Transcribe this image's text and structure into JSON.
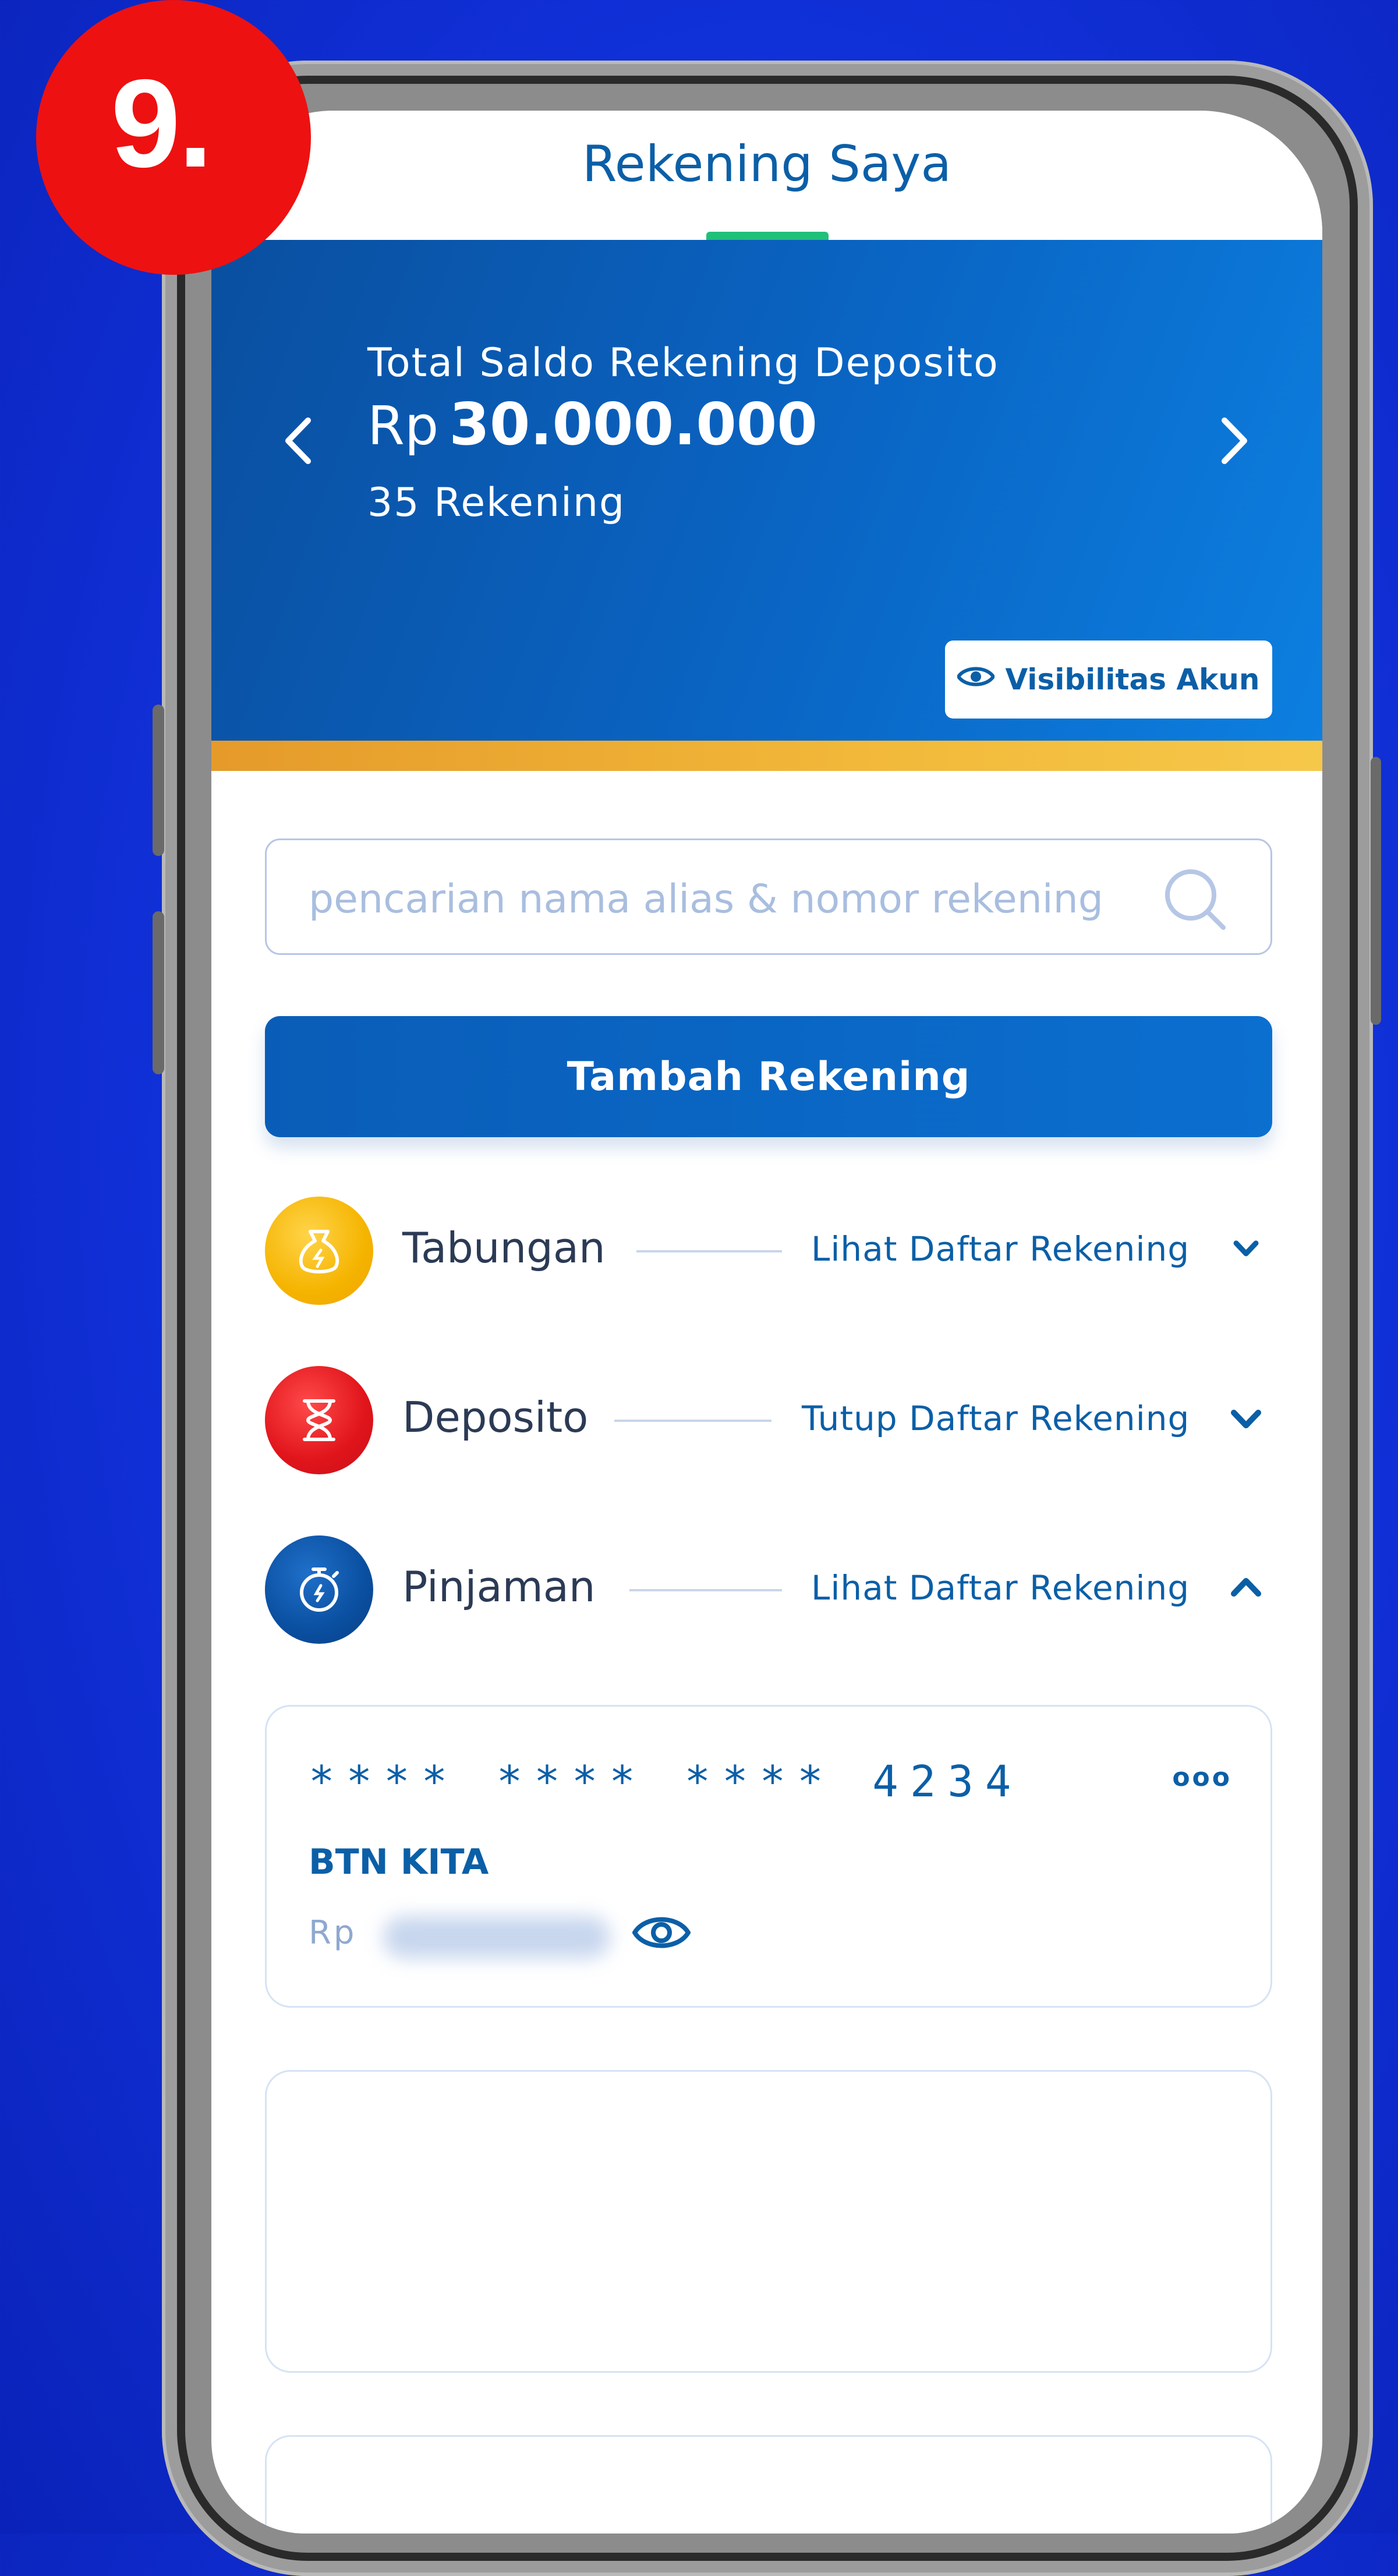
{
  "step_badge": "9.",
  "header": {
    "title": "Rekening Saya"
  },
  "summary": {
    "label": "Total Saldo Rekening Deposito",
    "currency": "Rp",
    "amount": "30.000.000",
    "account_count": "35 Rekening",
    "visibility_button": "Visibilitas Akun",
    "prev_icon": "chevron-left-icon",
    "next_icon": "chevron-right-icon"
  },
  "search": {
    "placeholder": "pencarian nama alias & nomor rekening",
    "value": "",
    "icon": "search-icon"
  },
  "add_account_button": "Tambah Rekening",
  "categories": [
    {
      "name": "Tabungan",
      "link": "Lihat Daftar Rekening",
      "icon": "money-bag-icon",
      "color": "#f5b400",
      "arrow": "chevron-down-icon"
    },
    {
      "name": "Deposito",
      "link": "Tutup Daftar Rekening",
      "icon": "hourglass-icon",
      "color": "#e0141b",
      "arrow": "chevron-down-icon"
    },
    {
      "name": "Pinjaman",
      "link": "Lihat Daftar Rekening",
      "icon": "stopwatch-icon",
      "color": "#0a4fa0",
      "arrow": "chevron-up-icon"
    }
  ],
  "accounts": [
    {
      "masked_number": "**** **** **** 4234",
      "name": "BTN KITA",
      "currency": "Rp",
      "balance_hidden": true,
      "more_label": "ooo"
    }
  ],
  "colors": {
    "primary": "#0b5fa7",
    "background": "#1234e0",
    "badge": "#ee1111",
    "accent_gold": "#f2b93a"
  }
}
